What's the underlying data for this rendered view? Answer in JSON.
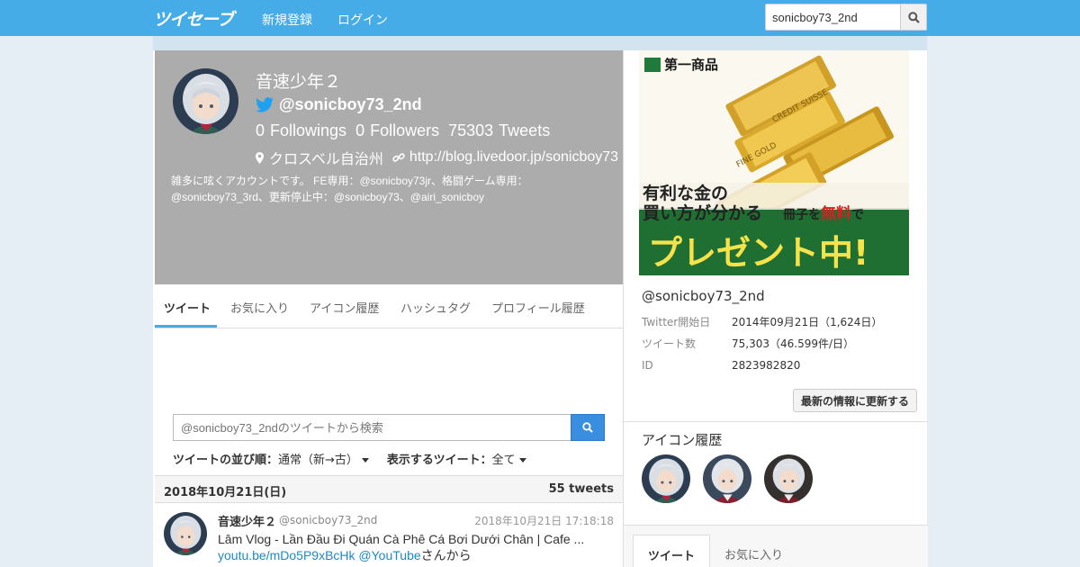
{
  "nav": {
    "logo": "ツイセーブ",
    "signup": "新規登録",
    "login": "ログイン",
    "search_value": "sonicboy73_2nd"
  },
  "profile": {
    "name": "音速少年２",
    "handle": "@sonicboy73_2nd",
    "followings": "0",
    "followings_label": "Followings",
    "followers": "0",
    "followers_label": "Followers",
    "tweets": "75303",
    "tweets_label": "Tweets",
    "location": "クロスベル自治州",
    "url": "http://blog.livedoor.jp/sonicboy73",
    "bio": "雑多に呟くアカウントです。 FE専用：@sonicboy73jr、格闘ゲーム専用：@sonicboy73_3rd、更新停止中：@sonicboy73、@airi_sonicboy"
  },
  "tabs": [
    "ツイート",
    "お気に入り",
    "アイコン履歴",
    "ハッシュタグ",
    "プロフィール履歴"
  ],
  "tweet_search": {
    "placeholder": "@sonicboy73_2ndのツイートから検索"
  },
  "sort": {
    "order_label": "ツイートの並び順：",
    "order_value": "通常（新→古）",
    "show_label": "表示するツイート：",
    "show_value": "全て"
  },
  "date_header": {
    "date": "2018年10月21日(日)",
    "count": "55 tweets"
  },
  "tweet": {
    "name": "音速少年２",
    "handle": "@sonicboy73_2nd",
    "time": "2018年10月21日 17:18:18",
    "text_before": "Lâm Vlog - Lần Đầu Đi Quán Cà Phê Cá Bơi Dưới Chân | Cafe ... ",
    "link": "youtu.be/mDo5P9xBcHk",
    "mention": "@YouTube",
    "text_after": "さんから"
  },
  "ad": {
    "brand": "第一商品",
    "line1": "有利な金の",
    "line2": "買い方が分かる",
    "line3": "冊子を",
    "line3_em": "無料",
    "line3_end": "で",
    "line4": "プレゼント中!",
    "bar1": "CREDIT SUISSE",
    "bar2": "FINE GOLD"
  },
  "side_info": {
    "handle": "@sonicboy73_2nd",
    "rows": [
      {
        "k": "Twitter開始日",
        "v": "2014年09月21日（1,624日）"
      },
      {
        "k": "ツイート数",
        "v": "75,303（46.599件/日）"
      },
      {
        "k": "ID",
        "v": "2823982820"
      }
    ],
    "update_button": "最新の情報に更新する"
  },
  "icon_history": {
    "title": "アイコン履歴"
  },
  "side_tabs": [
    "ツイート",
    "お気に入り"
  ],
  "colors": {
    "nav": "#45ace8",
    "header_bg": "#acacac",
    "accent": "#45ace8",
    "link": "#1e88c6"
  }
}
